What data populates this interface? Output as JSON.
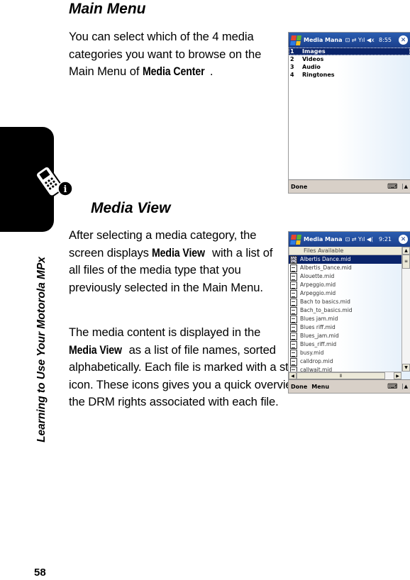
{
  "page": {
    "number": "58",
    "side_title": "Learning to Use Your Motorola MPx"
  },
  "main_menu": {
    "heading": "Main Menu",
    "para_before": "You can select which of the 4 media categories you want to browse on the Main Menu of ",
    "para_term": "Media Center",
    "para_after": "."
  },
  "media_view": {
    "heading": "Media View",
    "p1_before": "After selecting a media category, the screen displays ",
    "p1_term": "Media View",
    "p1_after": " with a list of all files of the media type that you previously selected in the Main Menu.",
    "p2_before": "The media content is displayed in the ",
    "p2_term": "Media View",
    "p2_after": " as a list of file names, sorted alphabetically. Each file is marked with a status icon. These icons gives you a quick overview of the DRM rights associated with each file."
  },
  "screen1": {
    "title": "Media Mana",
    "status_icons": "⊡ ⇄ Yıl ◀x",
    "time": "8:55",
    "items": [
      {
        "num": "1",
        "label": "Images"
      },
      {
        "num": "2",
        "label": "Videos"
      },
      {
        "num": "3",
        "label": "Audio"
      },
      {
        "num": "4",
        "label": "Ringtones"
      }
    ],
    "softkey_left": "Done"
  },
  "screen2": {
    "title": "Media Mana",
    "status_icons": "⊡ ⇄ Yıl ◀(",
    "time": "9:21",
    "column_header": "Files Available",
    "files": [
      "Albertis Dance.mid",
      "Albertis_Dance.mid",
      "Alouette.mid",
      "Arpeggio.mid",
      "Arpeggio.mid",
      "Bach to basics.mid",
      "Bach_to_basics.mid",
      "Blues jam.mid",
      "Blues riff.mid",
      "Blues_jam.mid",
      "Blues_riff.mid",
      "busy.mid",
      "calldrop.mid",
      "callwait.mid"
    ],
    "softkey_left": "Done",
    "softkey_right": "Menu"
  }
}
